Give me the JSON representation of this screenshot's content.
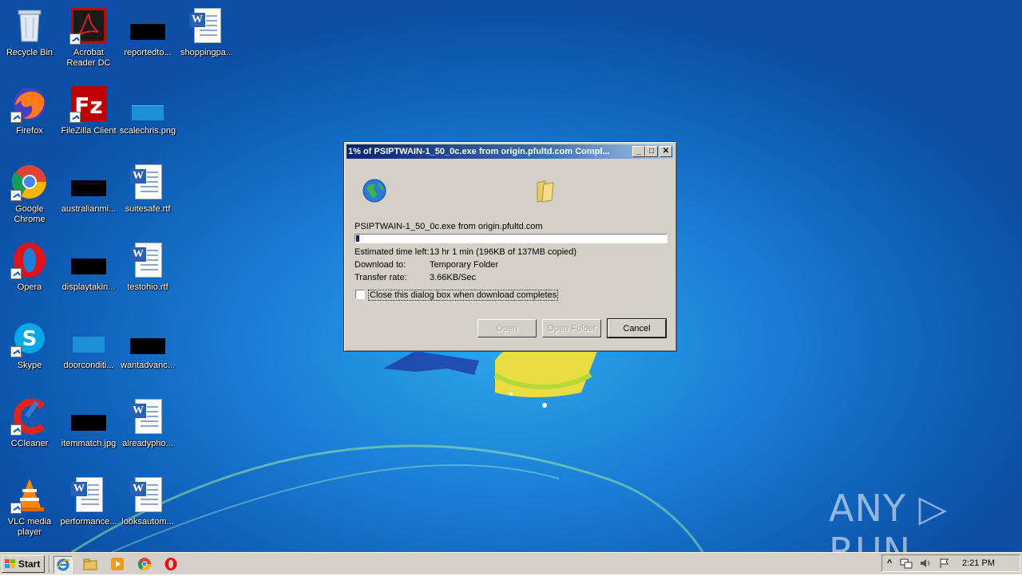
{
  "desktop_icons": [
    {
      "label": "Recycle Bin",
      "icon": "recycle-bin-icon"
    },
    {
      "label": "Acrobat Reader DC",
      "icon": "acrobat-reader-icon"
    },
    {
      "label": "reportedto...",
      "icon": "file-icon"
    },
    {
      "label": "shoppingpa...",
      "icon": "word-document-icon"
    },
    {
      "label": "Firefox",
      "icon": "firefox-icon"
    },
    {
      "label": "FileZilla Client",
      "icon": "filezilla-icon"
    },
    {
      "label": "scalechris.png",
      "icon": "image-file-icon"
    },
    {
      "label": "Google Chrome",
      "icon": "chrome-icon"
    },
    {
      "label": "australianmi...",
      "icon": "file-icon"
    },
    {
      "label": "suitesafe.rtf",
      "icon": "word-document-icon"
    },
    {
      "label": "Opera",
      "icon": "opera-icon"
    },
    {
      "label": "displaytakin...",
      "icon": "file-icon"
    },
    {
      "label": "testohio.rtf",
      "icon": "word-document-icon"
    },
    {
      "label": "Skype",
      "icon": "skype-icon"
    },
    {
      "label": "doorconditi...",
      "icon": "image-file-icon"
    },
    {
      "label": "wantadvanc...",
      "icon": "file-icon"
    },
    {
      "label": "CCleaner",
      "icon": "ccleaner-icon"
    },
    {
      "label": "itemmatch.jpg",
      "icon": "file-icon"
    },
    {
      "label": "alreadypho...",
      "icon": "word-document-icon"
    },
    {
      "label": "VLC media player",
      "icon": "vlc-icon"
    },
    {
      "label": "performance...",
      "icon": "word-document-icon"
    },
    {
      "label": "looksautom...",
      "icon": "word-document-icon"
    }
  ],
  "dialog": {
    "title": "1% of PSIPTWAIN-1_50_0c.exe from origin.pfultd.com Compl...",
    "file_source": "PSIPTWAIN-1_50_0c.exe from origin.pfultd.com",
    "progress_fraction": 0.01,
    "estimated_label": "Estimated time left:",
    "estimated_value": "13 hr 1 min (196KB of 137MB copied)",
    "download_to_label": "Download to:",
    "download_to_value": "Temporary Folder",
    "transfer_label": "Transfer rate:",
    "transfer_value": "3.66KB/Sec",
    "close_checkbox_label": "Close this dialog box when download completes",
    "close_checkbox_checked": false,
    "open_button": "Open",
    "open_folder_button": "Open Folder",
    "cancel_button": "Cancel",
    "minimize_glyph": "_",
    "maximize_glyph": "□",
    "close_glyph": "✕"
  },
  "taskbar": {
    "start_label": "Start",
    "clock": "2:21 PM",
    "tray_chevron": "^"
  },
  "watermark": "ANY ▷ RUN",
  "colors": {
    "titlebar_start": "#0a246a",
    "desktop_blue": "#1a7fd6",
    "dialog_face": "#d4d0c8"
  }
}
